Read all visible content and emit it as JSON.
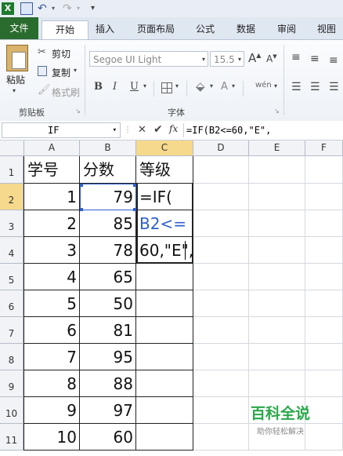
{
  "ribbon": {
    "tabs": [
      "文件",
      "开始",
      "插入",
      "页面布局",
      "公式",
      "数据",
      "审阅",
      "视图"
    ],
    "clipboard": {
      "paste": "粘贴",
      "cut": "剪切",
      "copy": "复制",
      "format_painter": "格式刷",
      "group_label": "剪贴板"
    },
    "font": {
      "family": "Segoe UI Light",
      "size": "15.5",
      "bold": "B",
      "italic": "I",
      "underline": "U",
      "group_label": "字体",
      "grow": "A",
      "shrink": "A",
      "phonetic": "wén"
    }
  },
  "formula_bar": {
    "name_box": "IF",
    "fx": "fx",
    "formula": "=IF(B2<=60,\"E\","
  },
  "columns": [
    "A",
    "B",
    "C",
    "D",
    "E",
    "F"
  ],
  "rows": [
    {
      "num": "1",
      "a": "学号",
      "b": "分数",
      "c": "等级"
    },
    {
      "num": "2",
      "a": "1",
      "b": "79",
      "c": "=IF("
    },
    {
      "num": "3",
      "a": "2",
      "b": "85",
      "c": "B2<="
    },
    {
      "num": "4",
      "a": "3",
      "b": "78",
      "c": "60,\"E\","
    },
    {
      "num": "5",
      "a": "4",
      "b": "65",
      "c": ""
    },
    {
      "num": "6",
      "a": "5",
      "b": "50",
      "c": ""
    },
    {
      "num": "7",
      "a": "6",
      "b": "81",
      "c": ""
    },
    {
      "num": "8",
      "a": "7",
      "b": "95",
      "c": ""
    },
    {
      "num": "9",
      "a": "8",
      "b": "88",
      "c": ""
    },
    {
      "num": "10",
      "a": "9",
      "b": "97",
      "c": ""
    },
    {
      "num": "11",
      "a": "10",
      "b": "60",
      "c": ""
    }
  ],
  "watermark": {
    "title": "百科全说",
    "subtitle": "助你轻松解决"
  }
}
